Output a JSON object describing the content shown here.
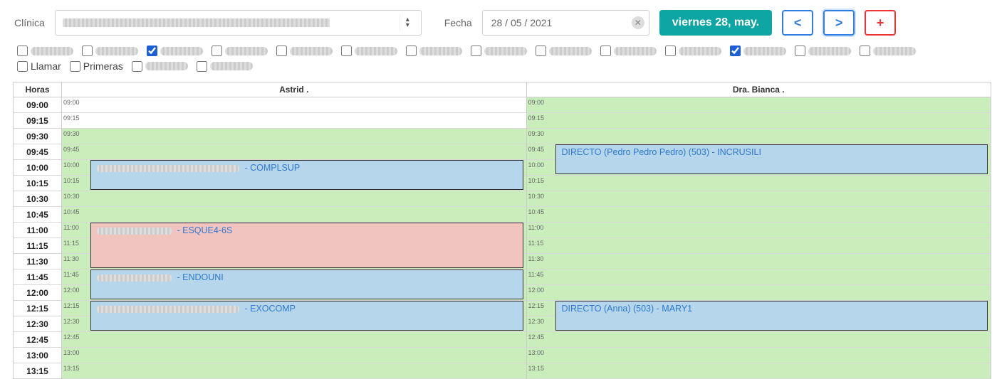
{
  "header": {
    "clinic_label": "Clínica",
    "date_label": "Fecha",
    "date_value": "28 / 05 / 2021",
    "date_badge": "viernes 28, may.",
    "prev": "<",
    "next": ">",
    "add": "+"
  },
  "filter_checks_row1_count": 14,
  "filter_checks_checked_indices": [
    2,
    11
  ],
  "filter_row2": {
    "llamar": "Llamar",
    "primeras": "Primeras"
  },
  "schedule": {
    "hours_label": "Horas",
    "providers": [
      "Astrid .",
      "Dra. Bianca ."
    ],
    "slots": [
      "09:00",
      "09:15",
      "09:30",
      "09:45",
      "10:00",
      "10:15",
      "10:30",
      "10:45",
      "11:00",
      "11:15",
      "11:30",
      "11:45",
      "12:00",
      "12:15",
      "12:30",
      "12:45",
      "13:00",
      "13:15"
    ],
    "p0_white_until": 2,
    "p1_white_until": 0,
    "appointments": {
      "p0": [
        {
          "start": 4,
          "span": 2,
          "color": "blue",
          "prefix_blur": "long",
          "text": " - COMPLSUP"
        },
        {
          "start": 8,
          "span": 3,
          "color": "pink",
          "prefix_blur": "short",
          "text": " - ESQUE4-6S"
        },
        {
          "start": 11,
          "span": 2,
          "color": "blue",
          "prefix_blur": "short",
          "text": " - ENDOUNI"
        },
        {
          "start": 13,
          "span": 2,
          "color": "blue",
          "prefix_blur": "long",
          "text": " - EXOCOMP"
        }
      ],
      "p1": [
        {
          "start": 3,
          "span": 2,
          "color": "blue",
          "prefix_blur": "none",
          "text": "DIRECTO (Pedro Pedro Pedro) (503) - INCRUSILI"
        },
        {
          "start": 13,
          "span": 2,
          "color": "blue",
          "prefix_blur": "none",
          "text": "DIRECTO (Anna) (503) - MARY1"
        }
      ]
    }
  }
}
